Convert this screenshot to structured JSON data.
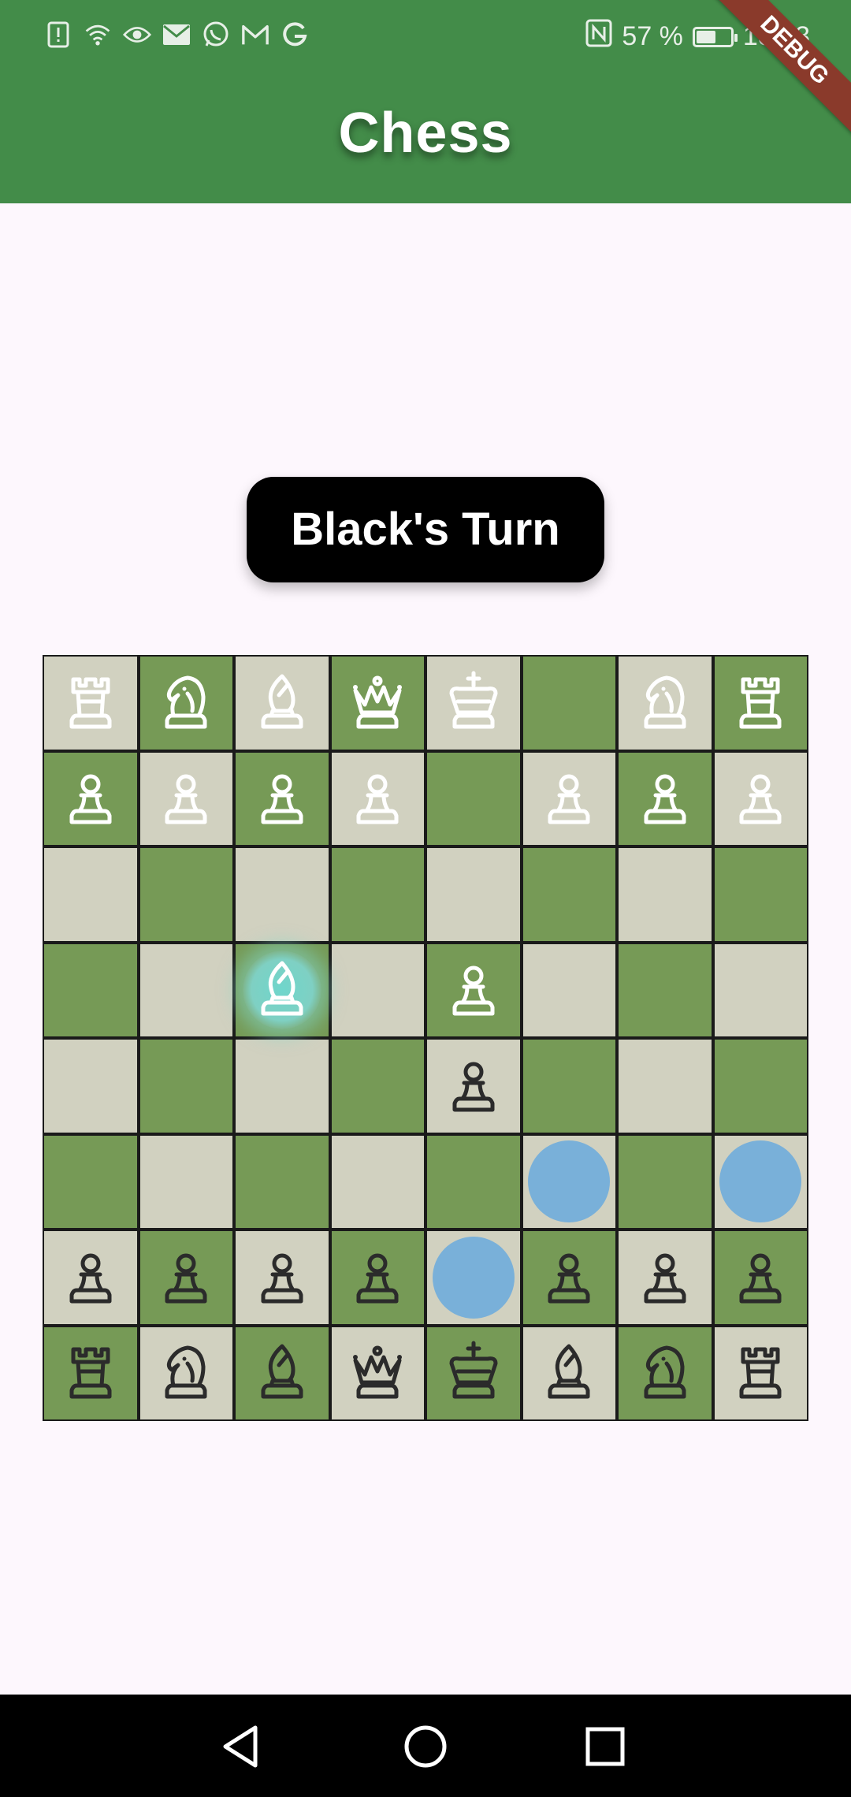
{
  "statusbar": {
    "left_icons": [
      "alert-icon",
      "wifi-icon",
      "eye-icon",
      "mail-icon",
      "whatsapp-icon",
      "gmail-icon",
      "google-icon"
    ],
    "nfc_icon": "nfc-icon",
    "battery_percent": "57 %",
    "battery_level": 0.57,
    "time": "18:03"
  },
  "appbar": {
    "title": "Chess",
    "color": "#438c49",
    "debug_label": "DEBUG"
  },
  "turn_indicator": "Black's Turn",
  "board": {
    "light_color": "#d1d1c0",
    "dark_color": "#769a56",
    "piece_outline_colors": {
      "white": "#ffffff",
      "black": "#2b2b2b"
    },
    "selected_square": "c5",
    "move_hints": [
      "f3",
      "h3",
      "e2"
    ],
    "rows": [
      [
        "wR",
        "wN",
        "wB",
        "wQ",
        "wK",
        "",
        "wN",
        "wR"
      ],
      [
        "wP",
        "wP",
        "wP",
        "wP",
        "",
        "wP",
        "wP",
        "wP"
      ],
      [
        "",
        "",
        "",
        "",
        "",
        "",
        "",
        ""
      ],
      [
        "",
        "",
        "wB",
        "",
        "wP",
        "",
        "",
        ""
      ],
      [
        "",
        "",
        "",
        "",
        "bP",
        "",
        "",
        ""
      ],
      [
        "",
        "",
        "",
        "",
        "",
        "",
        "",
        ""
      ],
      [
        "bP",
        "bP",
        "bP",
        "bP",
        "",
        "bP",
        "bP",
        "bP"
      ],
      [
        "bR",
        "bN",
        "bB",
        "bQ",
        "bK",
        "bB",
        "bN",
        "bR"
      ]
    ],
    "hint_color": "#79b0d9"
  },
  "navbar": {
    "back": "back-triangle-icon",
    "home": "home-circle-icon",
    "recents": "recents-square-icon"
  }
}
